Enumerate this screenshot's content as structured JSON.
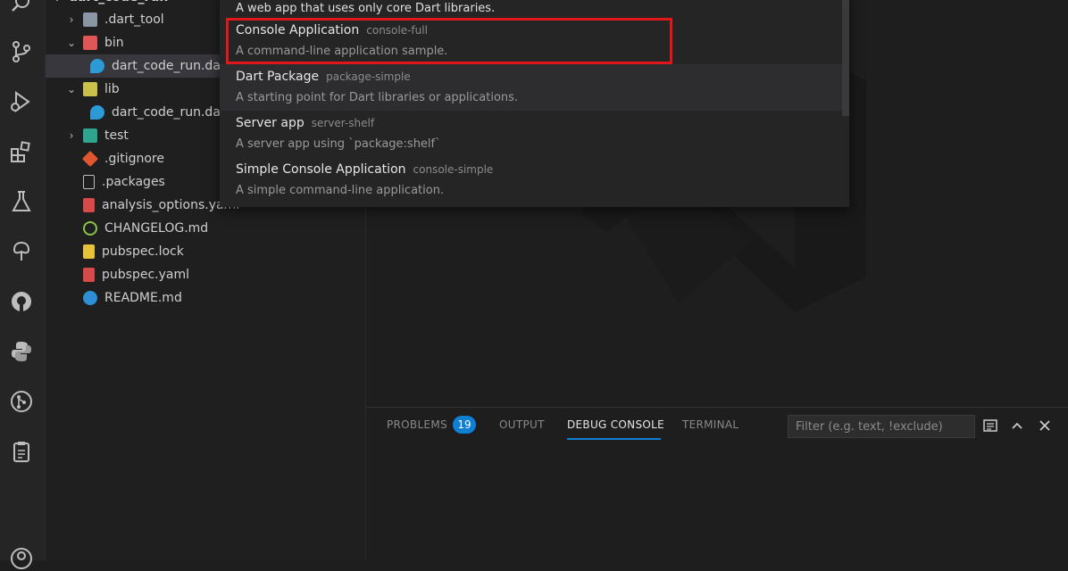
{
  "activity_bar": {
    "icons": [
      "search-icon",
      "source-control-icon",
      "run-debug-icon",
      "extensions-icon",
      "testing-icon",
      "remote-explorer-icon",
      "github-icon",
      "python-icon",
      "git-graph-icon",
      "clipboard-icon",
      "account-icon"
    ]
  },
  "explorer": {
    "items": [
      {
        "label": "dart_code_run",
        "icon": "folder",
        "chevron": "open",
        "indent": 0
      },
      {
        "label": ".dart_tool",
        "icon": "folder",
        "chevron": "closed",
        "indent": 1
      },
      {
        "label": "bin",
        "icon": "folder-bin",
        "chevron": "open",
        "indent": 1
      },
      {
        "label": "dart_code_run.dart",
        "icon": "dart-file",
        "chevron": "",
        "indent": 2,
        "selected": true
      },
      {
        "label": "lib",
        "icon": "folder-lib",
        "chevron": "open",
        "indent": 1
      },
      {
        "label": "dart_code_run.dart",
        "icon": "dart-file",
        "chevron": "",
        "indent": 2
      },
      {
        "label": "test",
        "icon": "folder-test",
        "chevron": "closed",
        "indent": 1
      },
      {
        "label": ".gitignore",
        "icon": "git-file",
        "chevron": "",
        "indent": 1
      },
      {
        "label": ".packages",
        "icon": "plain-file",
        "chevron": "",
        "indent": 1
      },
      {
        "label": "analysis_options.yaml",
        "icon": "yaml-file",
        "chevron": "",
        "indent": 1
      },
      {
        "label": "CHANGELOG.md",
        "icon": "changelog-file",
        "chevron": "",
        "indent": 1
      },
      {
        "label": "pubspec.lock",
        "icon": "lock-file",
        "chevron": "",
        "indent": 1
      },
      {
        "label": "pubspec.yaml",
        "icon": "yaml-file",
        "chevron": "",
        "indent": 1
      },
      {
        "label": "README.md",
        "icon": "info-file",
        "chevron": "",
        "indent": 1
      }
    ]
  },
  "quick_pick": {
    "items": [
      {
        "label": "",
        "detail": "",
        "description": "A web app that uses only core Dart libraries."
      },
      {
        "label": "Console Application",
        "detail": "console-full",
        "description": "A command-line application sample.",
        "highlighted": true
      },
      {
        "label": "Dart Package",
        "detail": "package-simple",
        "description": "A starting point for Dart libraries or applications.",
        "hover": true
      },
      {
        "label": "Server app",
        "detail": "server-shelf",
        "description": "A server app using `package:shelf`"
      },
      {
        "label": "Simple Console Application",
        "detail": "console-simple",
        "description": "A simple command-line application."
      }
    ]
  },
  "panel": {
    "tabs": [
      {
        "label": "PROBLEMS",
        "active": false
      },
      {
        "label": "OUTPUT",
        "active": false
      },
      {
        "label": "DEBUG CONSOLE",
        "active": true
      },
      {
        "label": "TERMINAL",
        "active": false
      }
    ],
    "problems_count": "19",
    "filter_placeholder": "Filter (e.g. text, !exclude)",
    "actions": [
      "list-view-icon",
      "chevron-up-icon",
      "close-icon"
    ]
  },
  "colors": {
    "accent": "#0e7fd3",
    "highlight_box": "#e0161b",
    "background": "#1e1e1e"
  }
}
